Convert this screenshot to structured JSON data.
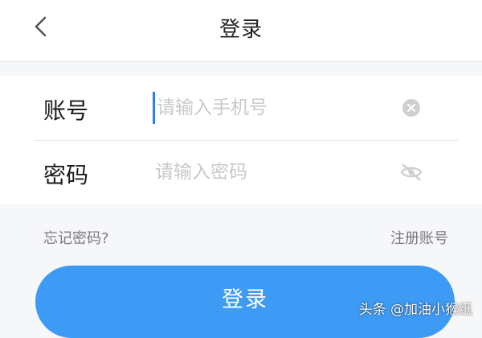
{
  "header": {
    "back_icon": "chevron-left-icon",
    "title": "登录"
  },
  "form": {
    "account": {
      "label": "账号",
      "placeholder": "请输入手机号",
      "value": "",
      "clear_icon": "clear-circle-icon"
    },
    "password": {
      "label": "密码",
      "placeholder": "请输入密码",
      "value": "",
      "visibility_icon": "eye-off-icon"
    }
  },
  "links": {
    "forgot_password": "忘记密码?",
    "register": "注册账号"
  },
  "login_button": {
    "label": "登录"
  },
  "watermark": "头条 @加油小猴纸",
  "colors": {
    "accent": "#3e9bf5",
    "caret": "#2f7df6",
    "background": "#f6f7f9",
    "icon": "#cfcfd2"
  }
}
